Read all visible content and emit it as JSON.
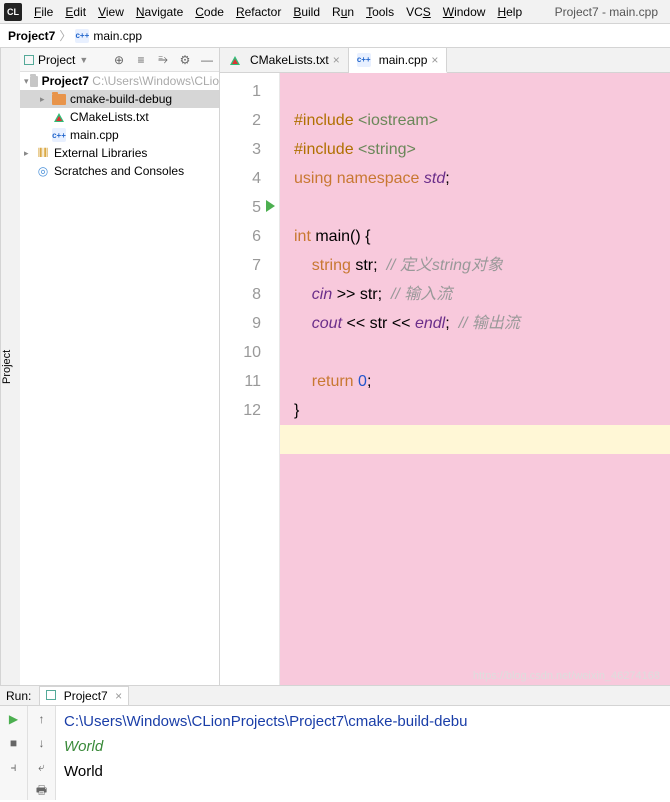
{
  "window_title": "Project7 - main.cpp",
  "menu": [
    "File",
    "Edit",
    "View",
    "Navigate",
    "Code",
    "Refactor",
    "Build",
    "Run",
    "Tools",
    "VCS",
    "Window",
    "Help"
  ],
  "breadcrumb": {
    "project": "Project7",
    "file": "main.cpp"
  },
  "sidebar_tab": "Project",
  "nav": {
    "header_label": "Project",
    "project_name": "Project7",
    "project_path": "C:\\Users\\Windows\\CLio",
    "items": {
      "build_dir": "cmake-build-debug",
      "cmake": "CMakeLists.txt",
      "main": "main.cpp",
      "ext_libs": "External Libraries",
      "scratches": "Scratches and Consoles"
    }
  },
  "tabs": {
    "cmake": "CMakeLists.txt",
    "main": "main.cpp"
  },
  "code": {
    "l1a": "#include ",
    "l1b": "<iostream>",
    "l2a": "#include ",
    "l2b": "<string>",
    "l3a": "using ",
    "l3b": "namespace ",
    "l3c": "std",
    "l3d": ";",
    "l5a": "int ",
    "l5b": "main",
    "l5c": "() {",
    "l6a": "    string ",
    "l6b": "str",
    "l6c": ";  ",
    "l6d": "// 定义string对象",
    "l7a": "    cin ",
    "l7b": ">> ",
    "l7c": "str",
    "l7d": ";  ",
    "l7e": "// 输入流",
    "l8a": "    cout ",
    "l8b": "<< ",
    "l8c": "str ",
    "l8d": "<< ",
    "l8e": "endl",
    "l8f": ";  ",
    "l8g": "// 输出流",
    "l10a": "    return ",
    "l10b": "0",
    "l10c": ";",
    "l11": "}"
  },
  "line_numbers": [
    "1",
    "2",
    "3",
    "4",
    "5",
    "6",
    "7",
    "8",
    "9",
    "10",
    "11",
    "12"
  ],
  "run": {
    "label": "Run:",
    "tab": "Project7",
    "path": "C:\\Users\\Windows\\CLionProjects\\Project7\\cmake-build-debu",
    "input": "World",
    "output": "World"
  },
  "watermark": "https://blog.csdn.net/weixin_46274168"
}
